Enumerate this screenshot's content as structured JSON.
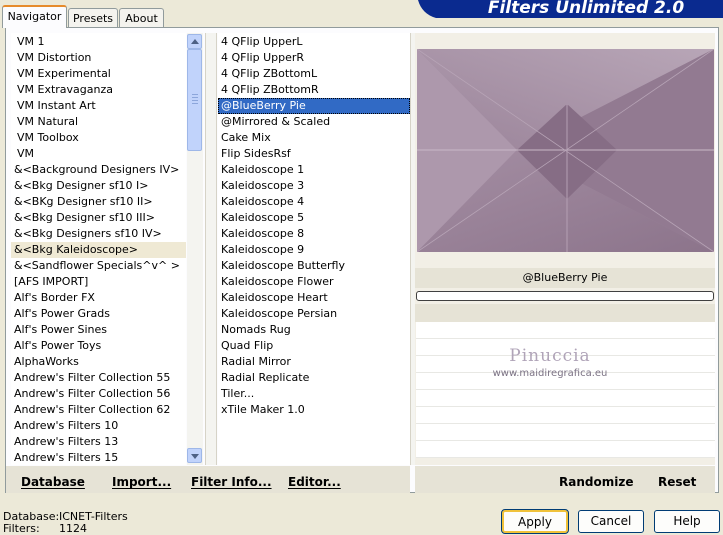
{
  "app": {
    "title": "Filters Unlimited 2.0"
  },
  "tabs": [
    {
      "label": "Navigator",
      "active": true
    },
    {
      "label": "Presets",
      "active": false
    },
    {
      "label": "About",
      "active": false
    }
  ],
  "categories": {
    "items": [
      "VM 1",
      "VM Distortion",
      "VM Experimental",
      "VM Extravaganza",
      "VM Instant Art",
      "VM Natural",
      "VM Toolbox",
      "VM",
      "&<Background Designers IV>",
      "&<Bkg Designer sf10 I>",
      "&<BKg Designer sf10 II>",
      "&<Bkg Designer sf10 III>",
      "&<Bkg Designers sf10 IV>",
      "&<Bkg Kaleidoscope>",
      "&<Sandflower Specials^v^ >",
      "[AFS IMPORT]",
      "Alf's Border FX",
      "Alf's Power Grads",
      "Alf's Power Sines",
      "Alf's Power Toys",
      "AlphaWorks",
      "Andrew's Filter Collection 55",
      "Andrew's Filter Collection 56",
      "Andrew's Filter Collection 62",
      "Andrew's Filters 10",
      "Andrew's Filters 13",
      "Andrew's Filters 15"
    ],
    "selected": "&<Bkg Kaleidoscope>"
  },
  "filters": {
    "items": [
      "4 QFlip UpperL",
      "4 QFlip UpperR",
      "4 QFlip ZBottomL",
      "4 QFlip ZBottomR",
      "@BlueBerry Pie",
      "@Mirrored & Scaled",
      "Cake Mix",
      "Flip SidesRsf",
      "Kaleidoscope 1",
      "Kaleidoscope 3",
      "Kaleidoscope 4",
      "Kaleidoscope 5",
      "Kaleidoscope 8",
      "Kaleidoscope 9",
      "Kaleidoscope Butterfly",
      "Kaleidoscope Flower",
      "Kaleidoscope Heart",
      "Kaleidoscope Persian",
      "Nomads Rug",
      "Quad Flip",
      "Radial Mirror",
      "Radial Replicate",
      "Tiler...",
      "xTile Maker 1.0"
    ],
    "selected": "@BlueBerry Pie"
  },
  "preview": {
    "filter_name": "@BlueBerry Pie",
    "progress": 0,
    "watermark_name": "Pinuccia",
    "watermark_url": "www.maidiregrafica.eu"
  },
  "toolbar": {
    "database": "Database",
    "import": "Import...",
    "filter_info": "Filter Info...",
    "editor": "Editor...",
    "randomize": "Randomize",
    "reset": "Reset"
  },
  "status": {
    "database_label": "Database:",
    "database_value": "ICNET-Filters",
    "filters_label": "Filters:",
    "filters_value": "1124"
  },
  "buttons": {
    "apply": "Apply",
    "cancel": "Cancel",
    "help": "Help"
  },
  "colors": {
    "selection": "#316ac5",
    "banner": "#0a2a8f",
    "preview_purple": "#9b8499"
  }
}
